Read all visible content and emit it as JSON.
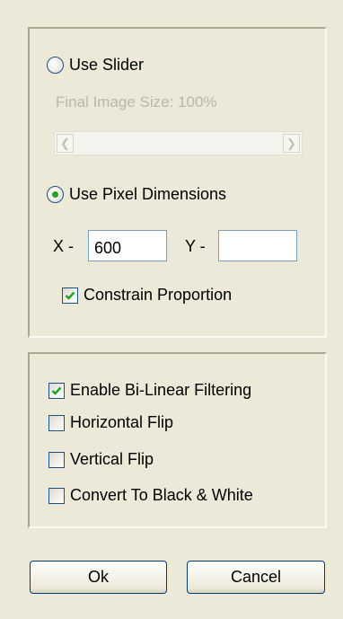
{
  "resize": {
    "use_slider_label": "Use Slider",
    "final_size_label": "Final Image Size: 100%",
    "use_pixels_label": "Use Pixel Dimensions",
    "x_label": "X -",
    "x_value": "600",
    "y_label": "Y -",
    "y_value": "",
    "constrain_label": "Constrain Proportion",
    "use_slider_selected": false,
    "use_pixels_selected": true,
    "constrain_checked": true
  },
  "options": {
    "bilinear_label": "Enable Bi-Linear Filtering",
    "hflip_label": "Horizontal Flip",
    "vflip_label": "Vertical Flip",
    "bw_label": "Convert To Black & White",
    "bilinear_checked": true,
    "hflip_checked": false,
    "vflip_checked": false,
    "bw_checked": false
  },
  "buttons": {
    "ok_label": "Ok",
    "cancel_label": "Cancel"
  },
  "icons": [
    "left-arrow-icon",
    "right-arrow-icon",
    "checkmark-icon"
  ],
  "colors": {
    "background": "#ece9d8",
    "check_green": "#21a121",
    "control_border": "#1c5180"
  }
}
